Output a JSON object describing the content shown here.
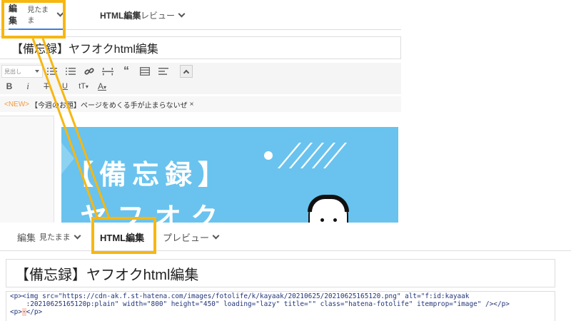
{
  "top_editor": {
    "tabs": {
      "edit_label": "編集",
      "edit_mode": "見たまま",
      "html_label": "HTML編集",
      "preview_label": "プレビュー"
    },
    "title_value": "【備忘録】ヤフオクhtml編集",
    "toolbar": {
      "heading_select": "見出し"
    },
    "notice": {
      "new_tag": "<NEW>",
      "text": "【今週のお題】ページをめくる手が止まらないぜ",
      "close": "×"
    },
    "image": {
      "line1": "【備忘録】",
      "line2": "ヤフオク"
    }
  },
  "bottom_editor": {
    "tabs": {
      "edit_label": "編集",
      "edit_mode": "見たまま",
      "html_label": "HTML編集",
      "preview_label": "プレビュー"
    },
    "title_value": "【備忘録】ヤフオクhtml編集",
    "code_lines": [
      "<p><img src=\"https://cdn-ak.f.st-hatena.com/images/fotolife/k/kayaak/20210625/20210625165120.png\" alt=\"f:id:kayaak",
      "    :20210625165120p:plain\" width=\"800\" height=\"450\" loading=\"lazy\" title=\"\" class=\"hatena-fotolife\" itemprop=\"image\" /></p>",
      "<p>",
      "</p>"
    ],
    "code_hl": "·"
  },
  "highlight_color": "#f7b711"
}
